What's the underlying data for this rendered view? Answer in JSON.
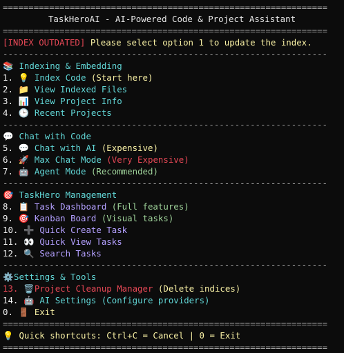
{
  "rule_double": "===============================================================",
  "rule_dash": "---------------------------------------------------------------",
  "header": {
    "title": "TaskHeroAI - AI-Powered Code & Project Assistant"
  },
  "status": {
    "badge": "[INDEX OUTDATED]",
    "message": " Please select option 1 to update the index."
  },
  "sections": {
    "indexing": {
      "icon": "books-icon",
      "glyph": "📚",
      "title": "Indexing & Embedding",
      "items": [
        {
          "num": "1.",
          "glyph": "💡",
          "label": "Index Code",
          "note": " (Start here)"
        },
        {
          "num": "2.",
          "glyph": "📁",
          "label": "View Indexed Files",
          "note": ""
        },
        {
          "num": "3.",
          "glyph": "📊",
          "label": "View Project Info",
          "note": ""
        },
        {
          "num": "4.",
          "glyph": "🕒",
          "label": "Recent Projects",
          "note": ""
        }
      ]
    },
    "chat": {
      "glyph": "💬",
      "title": "Chat with Code",
      "items": [
        {
          "num": "5.",
          "glyph": "💬",
          "label": "Chat with AI",
          "note": " (Expensive)"
        },
        {
          "num": "6.",
          "glyph": "🚀",
          "label": "Max Chat Mode",
          "note": " (Very Expensive)"
        },
        {
          "num": "7.",
          "glyph": "🤖",
          "label": "Agent Mode",
          "note": " (Recommended)"
        }
      ]
    },
    "taskhero": {
      "glyph": "🎯",
      "title": "TaskHero Management",
      "items": [
        {
          "num": "8.",
          "glyph": "📋",
          "label": "Task Dashboard",
          "note": " (Full features)"
        },
        {
          "num": "9.",
          "glyph": "🎯",
          "label": "Kanban Board",
          "note": " (Visual tasks)"
        },
        {
          "num": "10.",
          "glyph": "➕",
          "label": "Quick Create Task",
          "note": ""
        },
        {
          "num": "11.",
          "glyph": "👀",
          "label": "Quick View Tasks",
          "note": ""
        },
        {
          "num": "12.",
          "glyph": "🔍",
          "label": "Search Tasks",
          "note": ""
        }
      ]
    },
    "settings": {
      "glyph": "⚙️",
      "title": "Settings & Tools",
      "items": [
        {
          "num": "13.",
          "glyph": "🗑️",
          "label": "Project Cleanup Manager",
          "note": " (Delete indices)"
        },
        {
          "num": "14.",
          "glyph": "🤖",
          "label": "AI Settings",
          "note": " (Configure providers)"
        },
        {
          "num": "0.",
          "glyph": "🚪",
          "label": "Exit",
          "note": ""
        }
      ]
    }
  },
  "footer": {
    "glyph": "💡",
    "shortcuts": "Quick shortcuts: Ctrl+C = Cancel | 0 = Exit"
  }
}
